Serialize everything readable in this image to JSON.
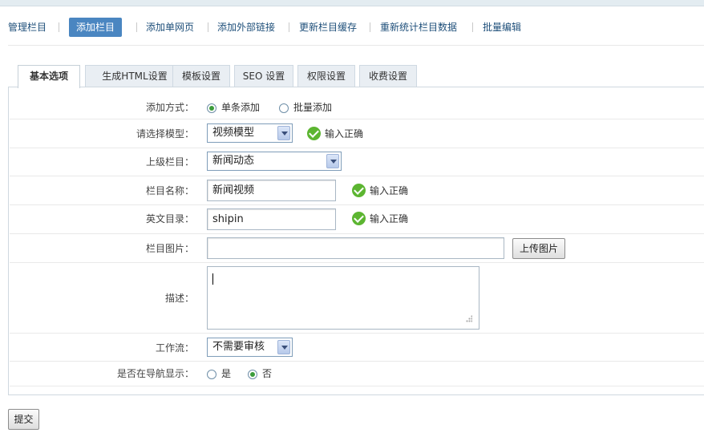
{
  "nav": {
    "manage": "管理栏目",
    "add": "添加栏目",
    "add_single": "添加单网页",
    "add_external": "添加外部链接",
    "update_cache": "更新栏目缓存",
    "recount": "重新统计栏目数据",
    "batch_edit": "批量编辑",
    "active_color": "#4a86c1"
  },
  "tabs": [
    "基本选项",
    "生成HTML设置",
    "模板设置",
    "SEO 设置",
    "权限设置",
    "收费设置"
  ],
  "form": {
    "add_mode": {
      "label": "添加方式：",
      "options": [
        "单条添加",
        "批量添加"
      ],
      "selected": "单条添加"
    },
    "model": {
      "label": "请选择模型：",
      "value": "视频模型",
      "status": "输入正确"
    },
    "parent": {
      "label": "上级栏目：",
      "value": "新闻动态"
    },
    "name": {
      "label": "栏目名称：",
      "value": "新闻视频",
      "status": "输入正确"
    },
    "dir": {
      "label": "英文目录：",
      "value": "shipin",
      "status": "输入正确"
    },
    "image": {
      "label": "栏目图片：",
      "value": "",
      "button": "上传图片"
    },
    "desc": {
      "label": "描述：",
      "value": ""
    },
    "workflow": {
      "label": "工作流：",
      "value": "不需要审核"
    },
    "nav_show": {
      "label": "是否在导航显示：",
      "options": [
        "是",
        "否"
      ],
      "selected": "否"
    }
  },
  "submit": "提交",
  "colors": {
    "ok_green": "#5cb531",
    "link_blue": "#1e4f7a"
  }
}
